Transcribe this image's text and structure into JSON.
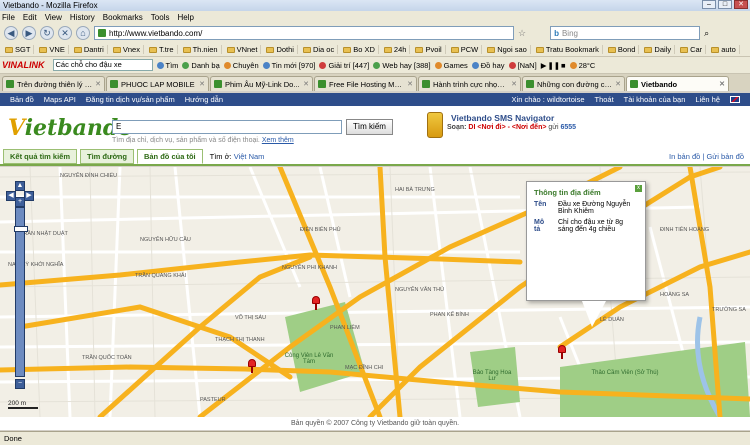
{
  "window": {
    "title": "Vietbando - Mozilla Firefox"
  },
  "menu": [
    "File",
    "Edit",
    "View",
    "History",
    "Bookmarks",
    "Tools",
    "Help"
  ],
  "nav": {
    "url": "http://www.vietbando.com/",
    "search_placeholder": "Bing"
  },
  "bookmarks": [
    "SGT",
    "VNE",
    "Dantri",
    "Vnex",
    "T.tre",
    "Th.nien",
    "VNnet",
    "Dothi",
    "Dia oc",
    "Bo XD",
    "24h",
    "Pvoil",
    "PCW",
    "Ngoi sao",
    "Tratu Bookmark",
    "Bond",
    "Daily",
    "Car",
    "auto"
  ],
  "toolbar": {
    "brand": "VINALINK",
    "search_value": "Các chỗ cho đậu xe",
    "items": [
      "Tìm",
      "Danh bạ",
      "Chuyên",
      "Tin mới [970]",
      "Giải trí [447]",
      "Web hay [388]",
      "Games",
      "Đồ hay",
      "[NaN]",
      "28°C"
    ]
  },
  "tabs": [
    {
      "label": "Trên đường thiên lý v..."
    },
    {
      "label": "PHUOC LAP MOBILE"
    },
    {
      "label": "Phim Âu Mỹ-Link Do..."
    },
    {
      "label": "Free File Hosting Ma..."
    },
    {
      "label": "Hành trình cực nhọc ..."
    },
    {
      "label": "Những con đường có..."
    },
    {
      "label": "Vietbando",
      "active": true
    }
  ],
  "site_nav": {
    "left": [
      "Bản đồ",
      "Maps API",
      "Đăng tin dịch vụ/sản phẩm",
      "Hướng dẫn"
    ],
    "greeting": "Xin chào : wildtortoise",
    "right": [
      "Thoát",
      "Tài khoản của bạn",
      "Liên hệ"
    ]
  },
  "header": {
    "logo_v": "V",
    "logo_rest": "ietbando",
    "search_value": "E",
    "search_button": "Tìm kiếm",
    "hint": "Tìm địa chỉ, dịch vụ, sản phẩm và số điện thoại.",
    "hint_link": "Xem thêm",
    "sms_title": "Vietbando SMS Navigator",
    "sms_prefix": "Soạn:",
    "sms_cmd": "DI <Nơi đi> - <Nơi đến>",
    "sms_mid": "gửi",
    "sms_number": "6555"
  },
  "site_tabs": {
    "items": [
      "Kết quả tìm kiếm",
      "Tìm đường",
      "Bản đồ của tôi"
    ],
    "search_in_label": "Tìm ở:",
    "search_in_value": "Việt Nam",
    "right": "In bản đồ | Gửi bản đồ"
  },
  "map": {
    "scale": "200 m",
    "popup": {
      "title": "Thông tin địa điểm",
      "close": "x",
      "name_label": "Tên",
      "name_value": "Đầu xe Đường Nguyễn Bỉnh Khiêm",
      "desc_label": "Mô tả",
      "desc_value": "Chỉ cho đậu xe từ 8g sáng đến 4g chiều"
    },
    "parks": [
      "Công Viên Lê Văn Tám",
      "Bảo Tàng Hoa Lư",
      "Thảo Cầm Viên (Sở Thú)"
    ],
    "streets": [
      "VÕ THỊ SÁU",
      "TRẦN QUANG KHẢI",
      "NGUYỄN PHI KHANH",
      "ĐIỆN BIÊN PHỦ",
      "NGUYỄN ĐÌNH CHIỂU",
      "HAI BÀ TRƯNG",
      "PHAN LIÊM",
      "TRẦN QUỐC TOẢN",
      "LÊ DUẨN",
      "NGUYỄN VĂN THỦ",
      "PHAN KẾ BÍNH",
      "MẠC ĐĨNH CHI",
      "PASTEUR",
      "NAM KỲ KHỞI NGHĨA",
      "THẠCH THỊ THANH",
      "TRẦN NHẬT DUẬT",
      "NGUYỄN HỮU CẦU",
      "HOÀNG SA",
      "TRƯỜNG SA",
      "ĐINH TIÊN HOÀNG"
    ]
  },
  "copyright": "Bản quyền © 2007 Công ty Vietbando giữ toàn quyền.",
  "status": "Done",
  "colors": {
    "site_nav_bg": "#2e4d8a",
    "logo_green": "#3a8a1f",
    "road_major": "#f7b21e",
    "road_minor": "#ffffff",
    "park": "#9fce86",
    "pin": "#e32424"
  }
}
